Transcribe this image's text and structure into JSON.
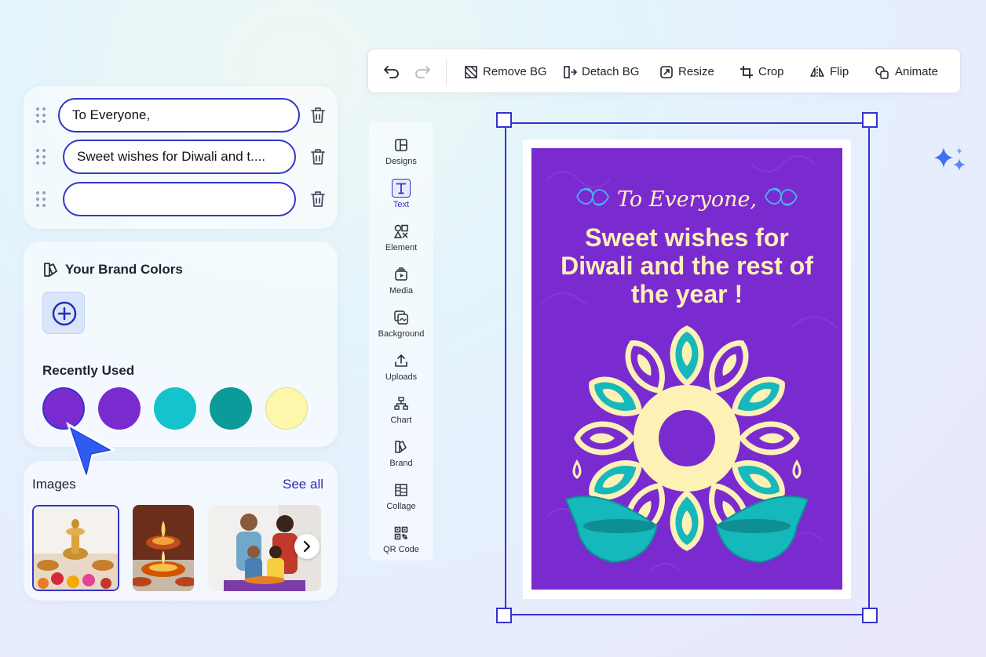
{
  "text_fields": [
    {
      "value": "To Everyone,"
    },
    {
      "value": "Sweet wishes for Diwali and t...."
    },
    {
      "value": ""
    }
  ],
  "brand": {
    "title": "Your Brand Colors",
    "recently_used_title": "Recently Used",
    "swatches": [
      "#7a2bcf",
      "#7a2bcf",
      "#14c3cc",
      "#0d9a9a",
      "#fdf7ab"
    ]
  },
  "images": {
    "title": "Images",
    "see_all": "See all"
  },
  "toolbar": {
    "remove_bg": "Remove BG",
    "detach_bg": "Detach BG",
    "resize": "Resize",
    "crop": "Crop",
    "flip": "Flip",
    "animate": "Animate"
  },
  "rail": [
    {
      "label": "Designs",
      "icon": "layout-icon"
    },
    {
      "label": "Text",
      "icon": "text-icon"
    },
    {
      "label": "Element",
      "icon": "shapes-icon"
    },
    {
      "label": "Media",
      "icon": "media-icon"
    },
    {
      "label": "Background",
      "icon": "background-icon"
    },
    {
      "label": "Uploads",
      "icon": "upload-icon"
    },
    {
      "label": "Chart",
      "icon": "chart-icon"
    },
    {
      "label": "Brand",
      "icon": "brand-icon"
    },
    {
      "label": "Collage",
      "icon": "collage-icon"
    },
    {
      "label": "QR Code",
      "icon": "qr-code-icon"
    }
  ],
  "card": {
    "greeting": "To Everyone,",
    "title": "Sweet wishes for Diwali and the rest of the year !",
    "colors": {
      "background": "#7a2bcf",
      "cream": "#fdf1b6",
      "teal": "#15b8bb"
    }
  },
  "colors": {
    "accent": "#3534c9"
  }
}
